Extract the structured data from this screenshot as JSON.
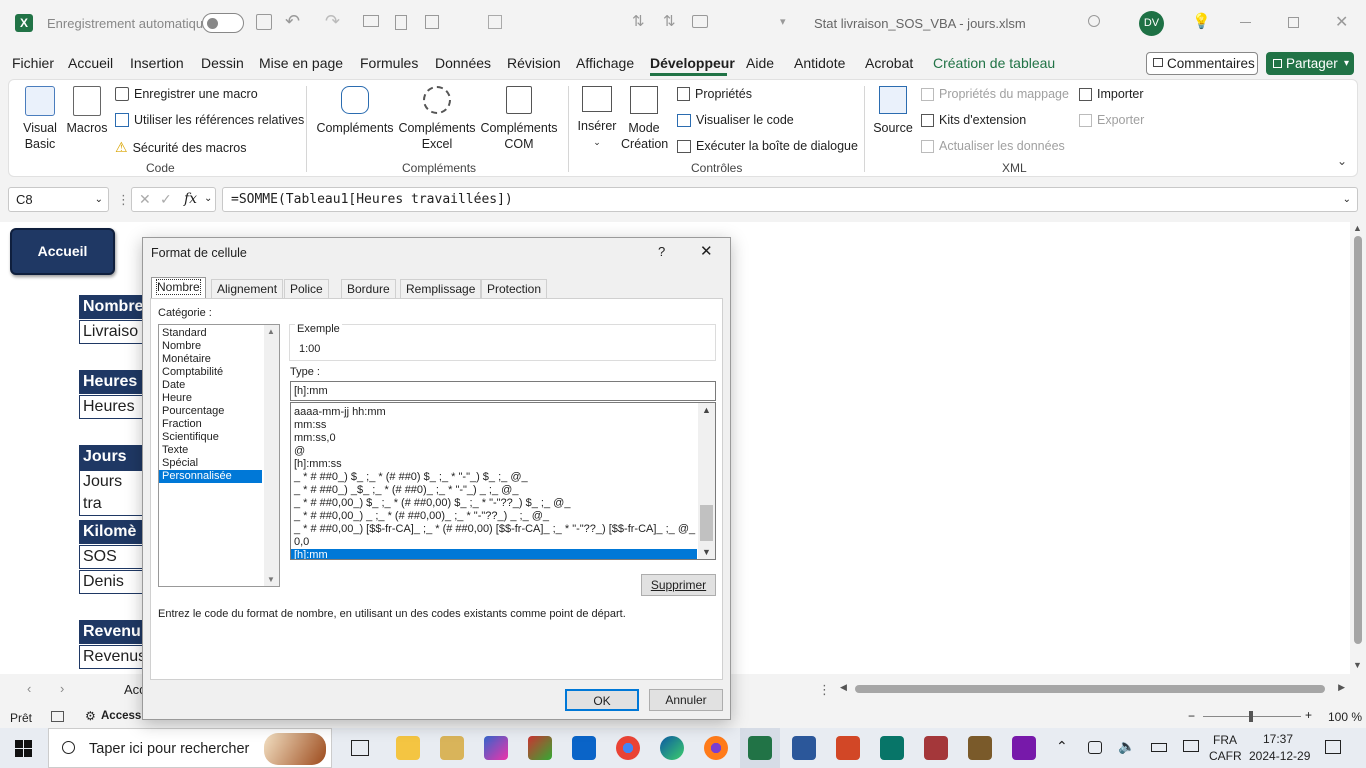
{
  "titlebar": {
    "autosave_label": "Enregistrement automatique",
    "file_title": "Stat livraison_SOS_VBA - jours.xlsm",
    "user_initials": "DV"
  },
  "tabs": [
    "Fichier",
    "Accueil",
    "Insertion",
    "Dessin",
    "Mise en page",
    "Formules",
    "Données",
    "Révision",
    "Affichage",
    "Développeur",
    "Aide",
    "Antidote",
    "Acrobat",
    "Création de tableau"
  ],
  "tabs_active": "Développeur",
  "tabs_buttons": {
    "comments": "Commentaires",
    "share": "Partager"
  },
  "ribbon": {
    "code": {
      "visual_basic": "Visual\nBasic",
      "macros": "Macros",
      "record_macro": "Enregistrer une macro",
      "relative_refs": "Utiliser les références relatives",
      "macro_security": "Sécurité des macros",
      "label": "Code"
    },
    "addins": {
      "addins": "Compléments",
      "excel_addins": "Compléments\nExcel",
      "com_addins": "Compléments\nCOM",
      "label": "Compléments"
    },
    "controls": {
      "insert": "Insérer",
      "design_mode": "Mode\nCréation",
      "properties": "Propriétés",
      "view_code": "Visualiser le code",
      "run_dialog": "Exécuter la boîte de dialogue",
      "label": "Contrôles"
    },
    "xml": {
      "source": "Source",
      "map_properties": "Propriétés du mappage",
      "expansion_packs": "Kits d'extension",
      "refresh_data": "Actualiser les données",
      "import": "Importer",
      "export": "Exporter",
      "label": "XML"
    }
  },
  "formula": {
    "namebox": "C8",
    "fx": "fx",
    "content": "=SOMME(Tableau1[Heures travaillées])"
  },
  "sheet": {
    "accueil_button": "Accueil",
    "blocks": [
      {
        "head": "Nombre",
        "rows": [
          "Livraiso"
        ]
      },
      {
        "head": "Heures",
        "rows": [
          "Heures"
        ]
      },
      {
        "head": "Jours tra",
        "rows": [
          "Jours tra"
        ]
      },
      {
        "head": "Kilomè",
        "rows": [
          "SOS",
          "Denis"
        ]
      },
      {
        "head": "Revenu",
        "rows": [
          "Revenus"
        ]
      }
    ],
    "sheet_tab": "Acc"
  },
  "dialog": {
    "title": "Format de cellule",
    "help": "?",
    "tabs": [
      "Nombre",
      "Alignement",
      "Police",
      "Bordure",
      "Remplissage",
      "Protection"
    ],
    "category_label": "Catégorie :",
    "categories": [
      "Standard",
      "Nombre",
      "Monétaire",
      "Comptabilité",
      "Date",
      "Heure",
      "Pourcentage",
      "Fraction",
      "Scientifique",
      "Texte",
      "Spécial",
      "Personnalisée"
    ],
    "selected_category": "Personnalisée",
    "example_label": "Exemple",
    "example_value": "1:00",
    "type_label": "Type :",
    "type_value": "[h]:mm",
    "formats": [
      "aaaa-mm-jj hh:mm",
      "mm:ss",
      "mm:ss,0",
      "@",
      "[h]:mm:ss",
      "_ * # ##0_) $_ ;_ * (# ##0) $_ ;_ * \"-\"_) $_ ;_ @_",
      "_ * # ##0_) _$_ ;_ * (# ##0)_ ;_ * \"-\"_) _ ;_ @_",
      "_ * # ##0,00_) $_ ;_ * (# ##0,00) $_ ;_ * \"-\"??_) $_ ;_ @_",
      "_ * # ##0,00_) _ ;_ * (# ##0,00)_ ;_ * \"-\"??_) _ ;_ @_",
      "_ * # ##0,00_) [$$-fr-CA]_ ;_ * (# ##0,00) [$$-fr-CA]_ ;_ * \"-\"??_) [$$-fr-CA]_ ;_ @_",
      "0,0",
      "[h]:mm"
    ],
    "selected_format": "[h]:mm",
    "delete_button": "Supprimer",
    "hint": "Entrez le code du format de nombre, en utilisant un des codes existants comme point de départ.",
    "ok": "OK",
    "cancel": "Annuler"
  },
  "status": {
    "ready": "Prêt",
    "accessibility": "Accessibilité : consultez nos recommandations",
    "zoom": "100 %"
  },
  "taskbar": {
    "search_placeholder": "Taper ici pour rechercher",
    "lang1": "FRA",
    "lang2": "CAFR",
    "time": "17:37",
    "date": "2024-12-29"
  },
  "colors": {
    "excel_green": "#217346",
    "header_navy": "#1f3864",
    "select_blue": "#0078d7"
  }
}
